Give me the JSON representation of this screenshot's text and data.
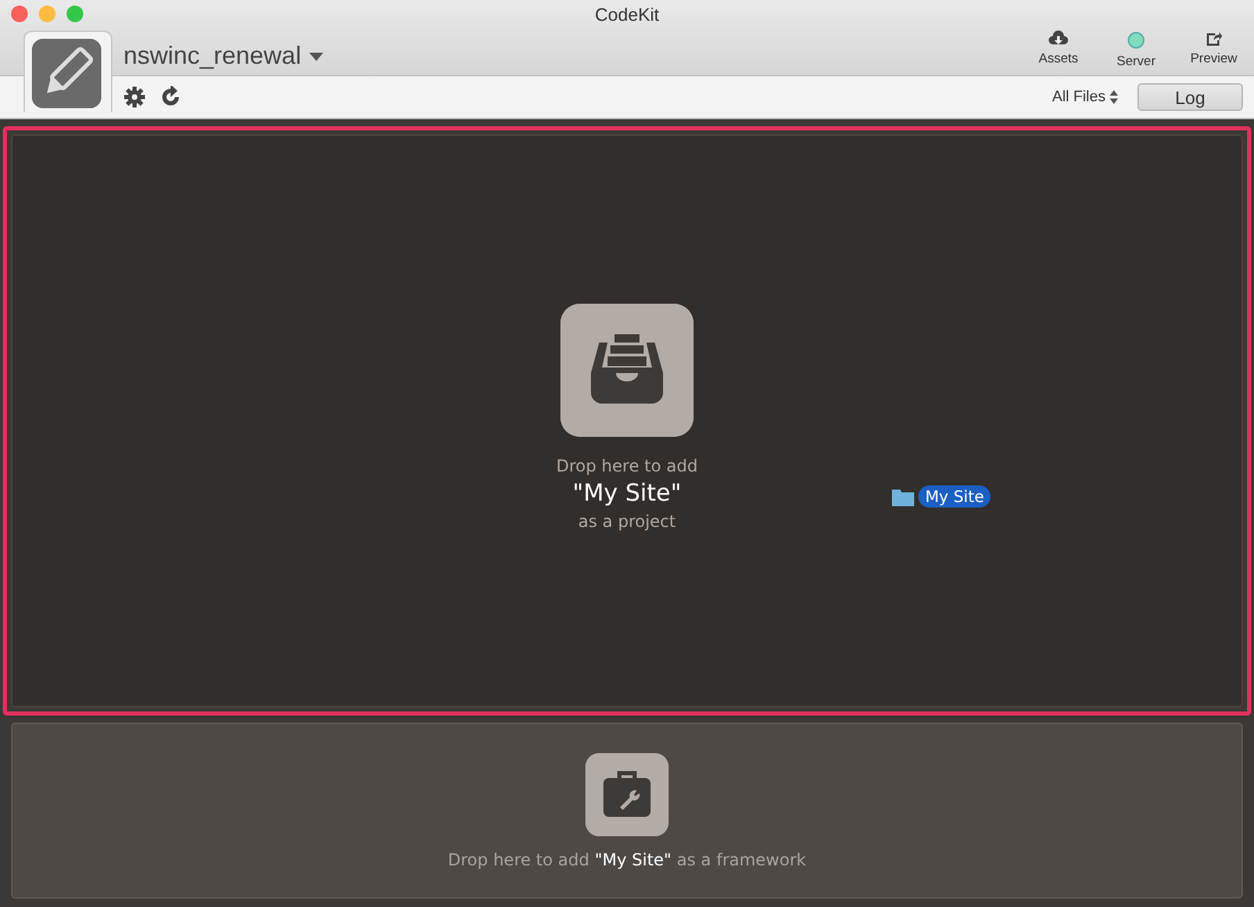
{
  "window": {
    "title": "CodeKit"
  },
  "project": {
    "name": "nswinc_renewal"
  },
  "toolbar": [
    {
      "kind": "assets",
      "label": "Assets"
    },
    {
      "kind": "server",
      "label": "Server"
    },
    {
      "kind": "preview",
      "label": "Preview"
    }
  ],
  "filter": {
    "value": "All Files"
  },
  "log_button": {
    "label": "Log"
  },
  "project_drop": {
    "line1": "Drop here to add",
    "name": "\"My Site\"",
    "line3": "as a project",
    "highlighted": true
  },
  "dragged_item": {
    "label": "My Site"
  },
  "framework_drop": {
    "text": "Drop here to add **\"My Site\"** as a framework"
  }
}
